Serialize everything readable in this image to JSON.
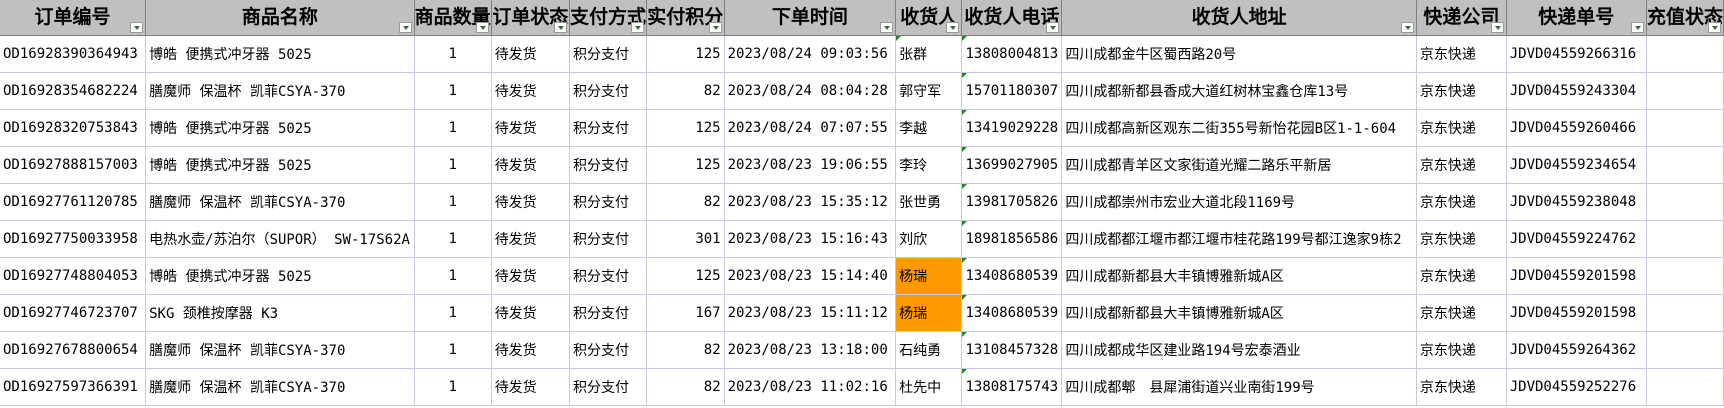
{
  "columns": [
    "订单编号",
    "商品名称",
    "商品数量",
    "订单状态",
    "支付方式",
    "实付积分",
    "下单时间",
    "收货人",
    "收货人电话",
    "收货人地址",
    "快递公司",
    "快递单号",
    "充值状态"
  ],
  "rows": [
    [
      "OD16928390364943",
      "博皓 便携式冲牙器 5025",
      "1",
      "待发货",
      "积分支付",
      "125",
      "2023/08/24 09:03:56",
      "张群",
      "13808004813",
      "四川成都金牛区蜀西路20号",
      "京东快递",
      "JDVD04559266316",
      ""
    ],
    [
      "OD16928354682224",
      "膳魔师 保温杯 凯菲CSYA-370",
      "1",
      "待发货",
      "积分支付",
      "82",
      "2023/08/24 08:04:28",
      "郭守军",
      "15701180307",
      "四川成都新都县香成大道红树林宝鑫仓库13号",
      "京东快递",
      "JDVD04559243304",
      ""
    ],
    [
      "OD16928320753843",
      "博皓 便携式冲牙器 5025",
      "1",
      "待发货",
      "积分支付",
      "125",
      "2023/08/24 07:07:55",
      "李越",
      "13419029228",
      "四川成都高新区观东二街355号新怡花园B区1-1-604",
      "京东快递",
      "JDVD04559260466",
      ""
    ],
    [
      "OD16927888157003",
      "博皓 便携式冲牙器 5025",
      "1",
      "待发货",
      "积分支付",
      "125",
      "2023/08/23 19:06:55",
      "李玲",
      "13699027905",
      "四川成都青羊区文家街道光耀二路乐平新居",
      "京东快递",
      "JDVD04559234654",
      ""
    ],
    [
      "OD16927761120785",
      "膳魔师 保温杯 凯菲CSYA-370",
      "1",
      "待发货",
      "积分支付",
      "82",
      "2023/08/23 15:35:12",
      "张世勇",
      "13981705826",
      "四川成都崇州市宏业大道北段1169号",
      "京东快递",
      "JDVD04559238048",
      ""
    ],
    [
      "OD16927750033958",
      "电热水壶/苏泊尔（SUPOR） SW-17S62A",
      "1",
      "待发货",
      "积分支付",
      "301",
      "2023/08/23 15:16:43",
      "刘欣",
      "18981856586",
      "四川成都都江堰市都江堰市桂花路199号都江逸家9栋2",
      "京东快递",
      "JDVD04559224762",
      ""
    ],
    [
      "OD16927748804053",
      "博皓 便携式冲牙器 5025",
      "1",
      "待发货",
      "积分支付",
      "125",
      "2023/08/23 15:14:40",
      "杨瑞",
      "13408680539",
      "四川成都新都县大丰镇博雅新城A区",
      "京东快递",
      "JDVD04559201598",
      ""
    ],
    [
      "OD16927746723707",
      "SKG 颈椎按摩器 K3",
      "1",
      "待发货",
      "积分支付",
      "167",
      "2023/08/23 15:11:12",
      "杨瑞",
      "13408680539",
      "四川成都新都县大丰镇博雅新城A区",
      "京东快递",
      "JDVD04559201598",
      ""
    ],
    [
      "OD16927678800654",
      "膳魔师 保温杯 凯菲CSYA-370",
      "1",
      "待发货",
      "积分支付",
      "82",
      "2023/08/23 13:18:00",
      "石纯勇",
      "13108457328",
      "四川成都成华区建业路194号宏泰酒业",
      "京东快递",
      "JDVD04559264362",
      ""
    ],
    [
      "OD16927597366391",
      "膳魔师 保温杯 凯菲CSYA-370",
      "1",
      "待发货",
      "积分支付",
      "82",
      "2023/08/23 11:02:16",
      "杜先中",
      "13808175743",
      "四川成都郫　县犀浦街道兴业南街199号",
      "京东快递",
      "JDVD04559252276",
      ""
    ]
  ],
  "highlighted_cells": [
    [
      6,
      7
    ],
    [
      7,
      7
    ]
  ],
  "highlight_color": "#ff9900",
  "header_bg": "#c0c0c0",
  "comment_marker_color": "#1e8a1e",
  "header_icon": "filter-dropdown-icon"
}
